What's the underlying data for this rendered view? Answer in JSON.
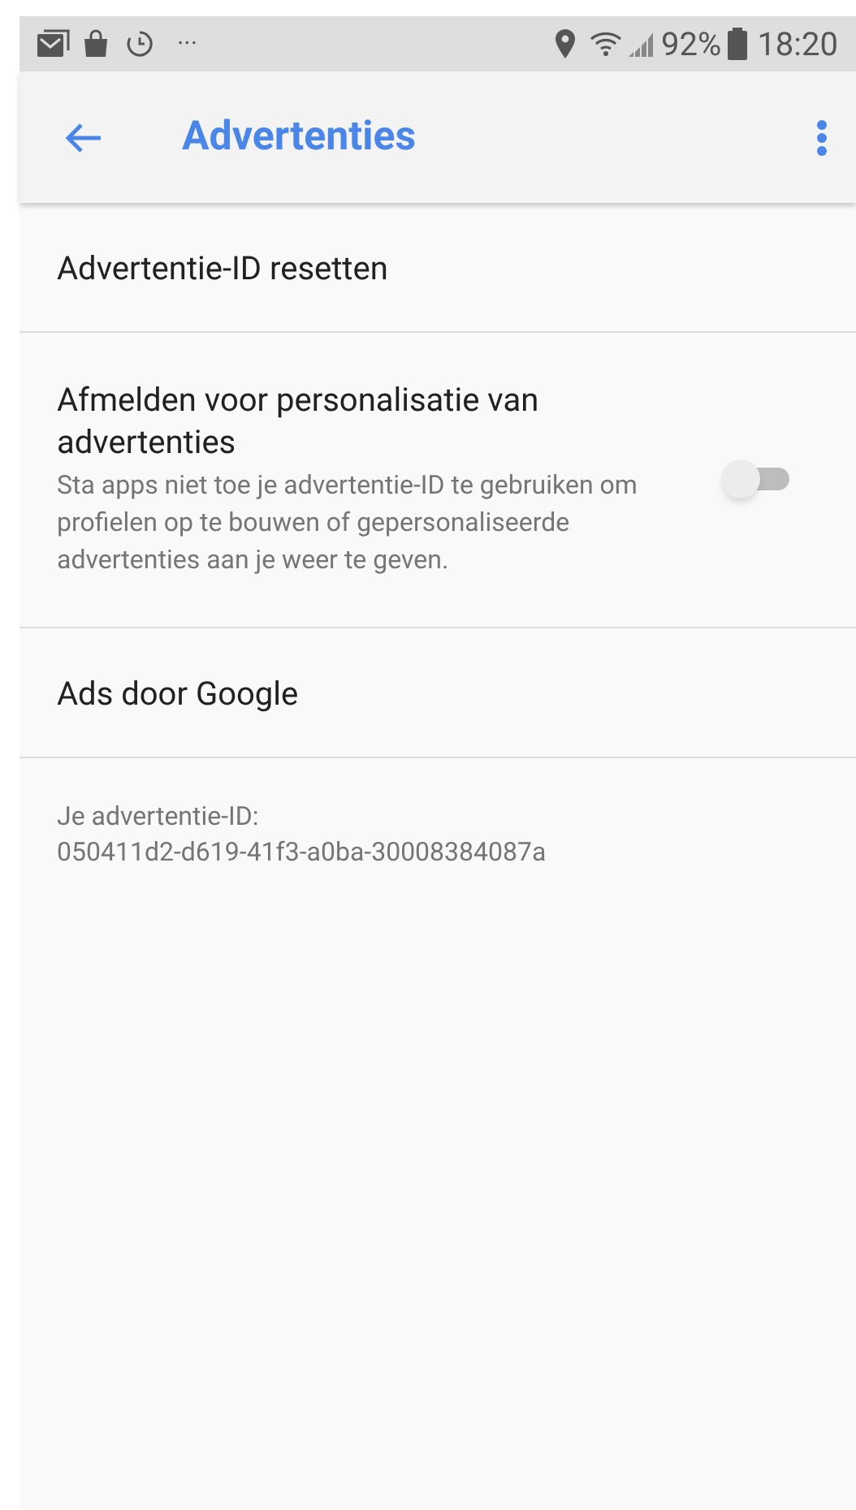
{
  "status_bar": {
    "more": "···",
    "battery": "92%",
    "time": "18:20"
  },
  "app_bar": {
    "title": "Advertenties"
  },
  "settings": [
    {
      "kind": "action",
      "title": "Advertentie-ID resetten"
    },
    {
      "kind": "toggle",
      "title": "Afmelden voor personalisatie van advertenties",
      "summary": "Sta apps niet toe je advertentie-ID te gebruiken om profielen op te bouwen of gepersonaliseerde advertenties aan je weer te geven.",
      "on": false
    },
    {
      "kind": "action",
      "title": "Ads door Google"
    }
  ],
  "footer": {
    "label": "Je advertentie-ID:",
    "value": "050411d2-d619-41f3-a0ba-30008384087a"
  }
}
